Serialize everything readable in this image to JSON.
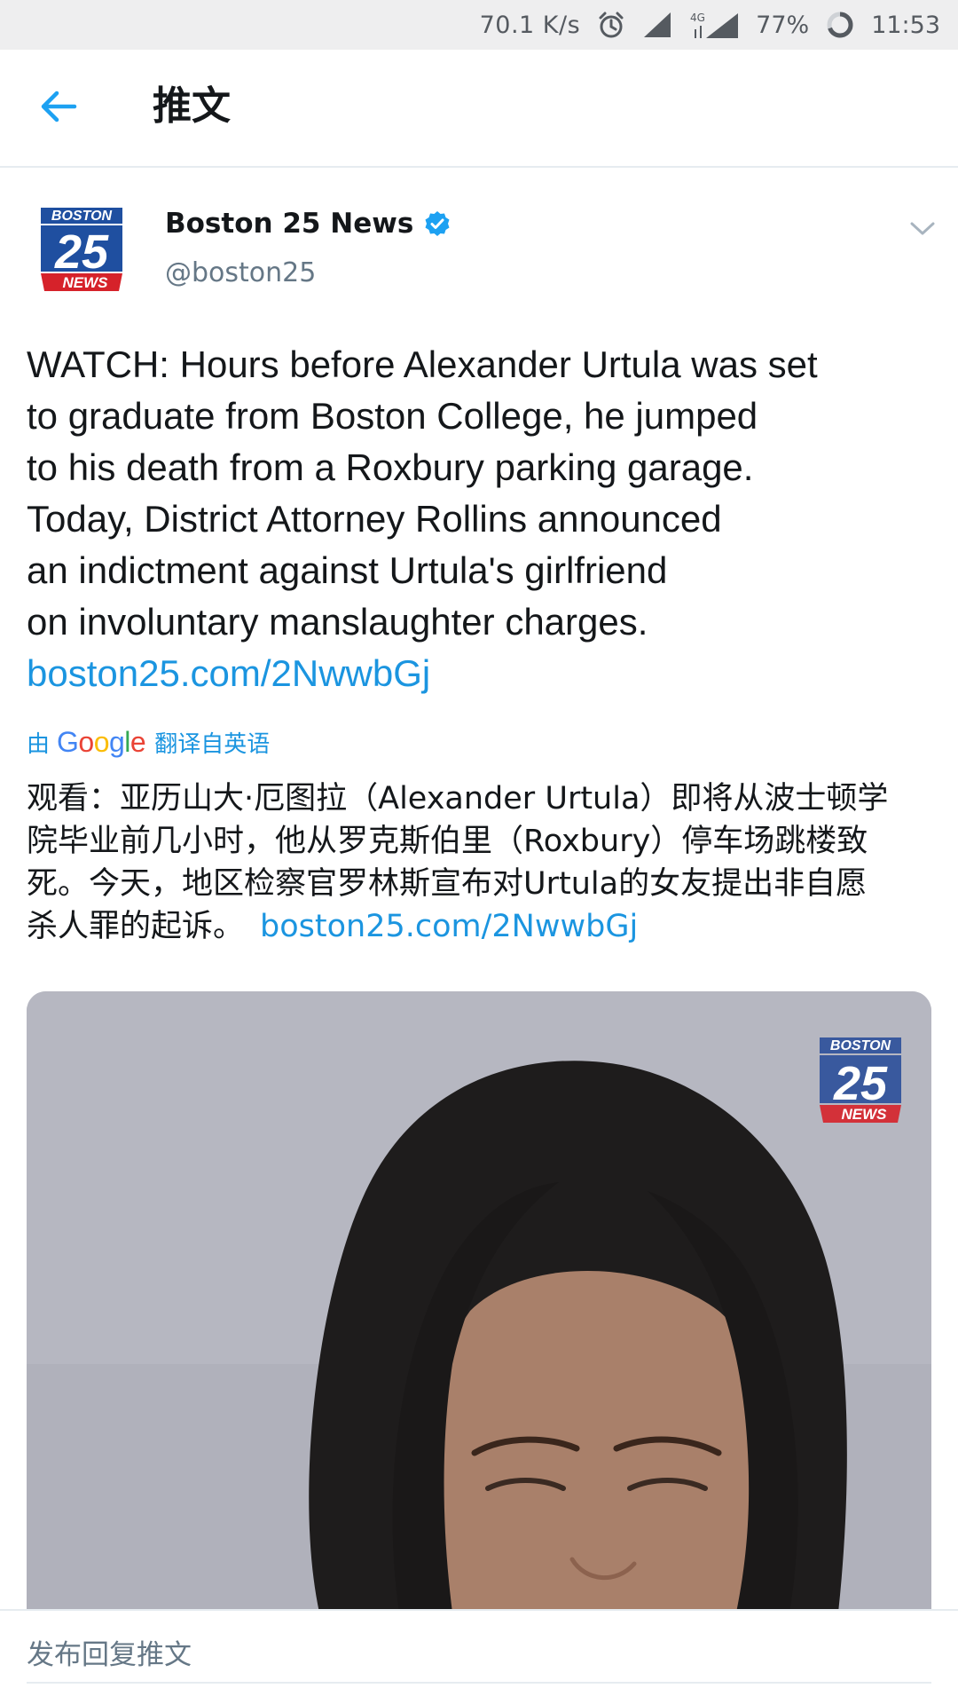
{
  "status_bar": {
    "network_speed": "70.1 K/s",
    "network_type": "4G",
    "battery": "77%",
    "time": "11:53"
  },
  "header": {
    "title": "推文"
  },
  "tweet": {
    "author_name": "Boston 25 News",
    "author_handle": "@boston25",
    "avatar_text": {
      "top": "BOSTON",
      "number": "25",
      "bottom": "NEWS"
    },
    "text_lines": [
      "WATCH: Hours before Alexander Urtula was set",
      "to graduate from Boston College, he jumped",
      "to his death from a Roxbury parking garage.",
      "Today, District Attorney  Rollins announced",
      "an indictment against Urtula's girlfriend",
      "on involuntary manslaughter charges."
    ],
    "link": "boston25.com/2NwwbGj"
  },
  "translation": {
    "prefix": "由",
    "provider": "Google",
    "suffix": "翻译自英语",
    "lines": [
      "观看：亚历山大·厄图拉（Alexander Urtula）即将从波士顿学",
      "院毕业前几小时，他从罗克斯伯里（Roxbury）停车场跳楼致",
      "死。今天，地区检察官罗林斯宣布对Urtula的女友提出非自愿",
      "杀人罪的起诉。"
    ],
    "link": "boston25.com/2NwwbGj"
  },
  "media": {
    "watermark": {
      "top": "BOSTON",
      "number": "25",
      "bottom": "NEWS"
    }
  },
  "reply": {
    "placeholder": "发布回复推文"
  },
  "colors": {
    "accent": "#1b95e0",
    "verified": "#1da1f2",
    "secondary_text": "#657786",
    "avatar_blue": "#1f4fa0",
    "avatar_red": "#d6222a"
  },
  "icons": {
    "back": "arrow-left-icon",
    "verified": "verified-badge-icon",
    "more": "chevron-down-icon",
    "alarm": "alarm-icon",
    "signal": "signal-icon",
    "battery": "battery-ring-icon"
  }
}
